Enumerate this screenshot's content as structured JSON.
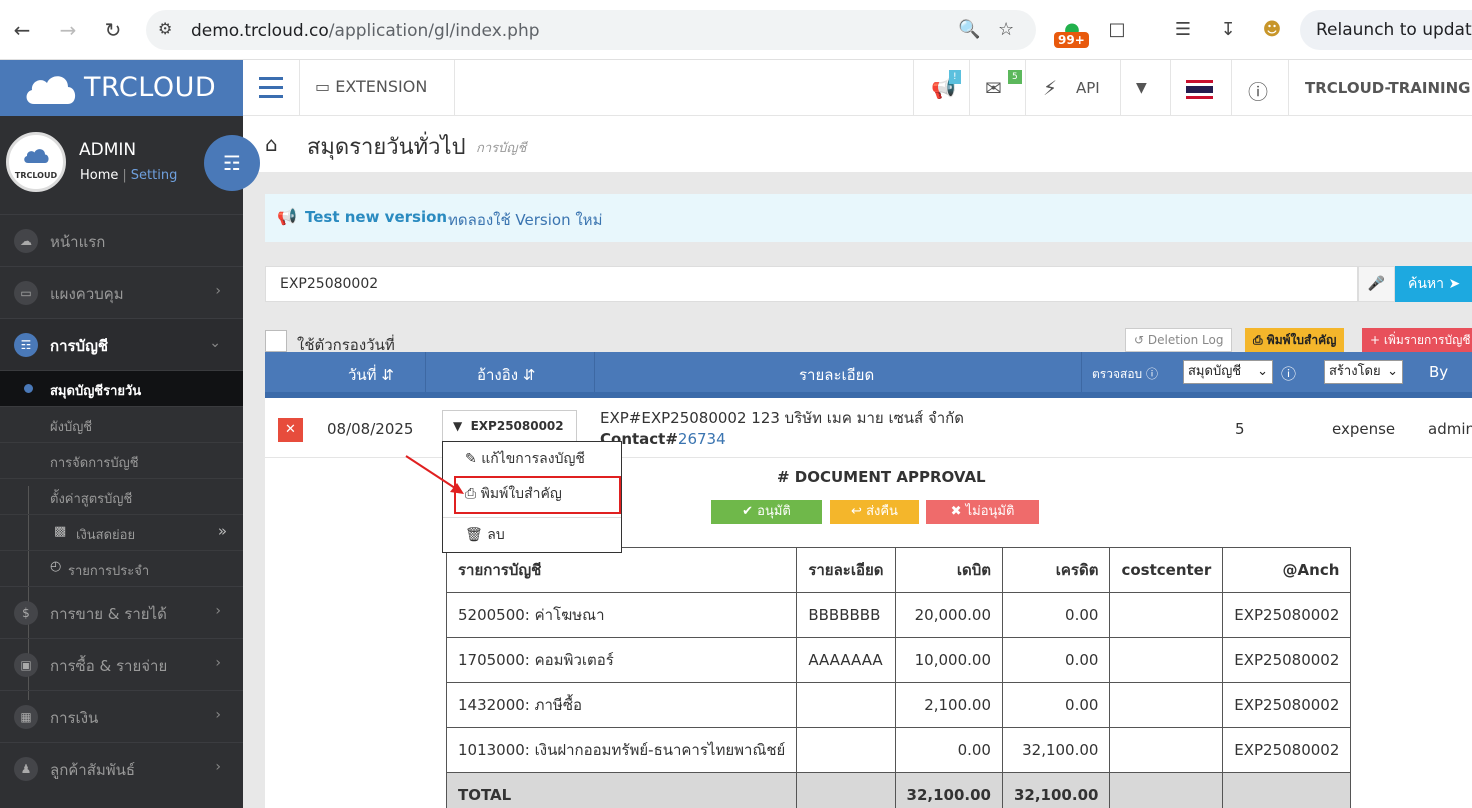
{
  "browser": {
    "url_host": "demo.trcloud.co",
    "url_path": "/application/gl/index.php",
    "badge_count": "99+",
    "relaunch_label": "Relaunch to updat"
  },
  "app": {
    "brand": "TRCLOUD",
    "extension_label": "EXTENSION",
    "announce_badge": "!",
    "mail_badge": "5",
    "api_label": "API",
    "company": "TRCLOUD-TRAINING"
  },
  "profile": {
    "avatar_text": "TRCLOUD",
    "name": "ADMIN",
    "home": "Home",
    "setting": "Setting"
  },
  "sidebar": {
    "items": [
      {
        "label": "หน้าแรก"
      },
      {
        "label": "แผงควบคุม"
      },
      {
        "label": "การบัญชี"
      },
      {
        "label": "การขาย & รายได้"
      },
      {
        "label": "การซื้อ & รายจ่าย"
      },
      {
        "label": "การเงิน"
      },
      {
        "label": "ลูกค้าสัมพันธ์"
      }
    ],
    "sub_items": [
      {
        "label": "สมุดบัญชีรายวัน"
      },
      {
        "label": "ผังบัญชี"
      },
      {
        "label": "การจัดการบัญชี"
      },
      {
        "label": "ตั้งค่าสูตรบัญชี"
      },
      {
        "label": "เงินสดย่อย"
      },
      {
        "label": "รายการประจำ"
      }
    ]
  },
  "page": {
    "title": "สมุดรายวันทั่วไป",
    "subtitle": "การบัญชี"
  },
  "notice": {
    "strong": "Test new version",
    "text": "ทดลองใช้ Version ใหม่"
  },
  "search": {
    "value": "EXP25080002",
    "button": "ค้นหา"
  },
  "toolbar": {
    "date_filter": "ใช้ตัวกรองวันที่",
    "deletion_log": "Deletion Log",
    "print_important": "พิมพ์ใบสำคัญ",
    "add_entry": "เพิ่มรายการบัญชี"
  },
  "table_head": {
    "date": "วันที่",
    "ref": "อ้างอิง",
    "detail": "รายละเอียด",
    "check": "ตรวจสอบ",
    "book_select": "สมุดบัญชี",
    "creator_select": "สร้างโดย",
    "by": "By"
  },
  "entry": {
    "date": "08/08/2025",
    "ref": "EXP25080002",
    "desc_line1": "EXP#EXP25080002 123 บริษัท เมค มาย เซนส์ จำกัด",
    "contact_label": "Contact#",
    "contact_id": "26734",
    "count": "5",
    "type": "expense",
    "by": "admin"
  },
  "dropdown": {
    "edit": "แก้ไขการลงบัญชี",
    "print": "พิมพ์ใบสำคัญ",
    "delete": "ลบ"
  },
  "approval": {
    "title": "# DOCUMENT APPROVAL",
    "approve": "อนุมัติ",
    "return": "ส่งคืน",
    "reject": "ไม่อนุมัติ"
  },
  "gl": {
    "headers": [
      "รายการบัญชี",
      "รายละเอียด",
      "เดบิต",
      "เครดิต",
      "costcenter",
      "@Anch"
    ],
    "rows": [
      [
        "5200500: ค่าโฆษณา",
        "BBBBBBB",
        "20,000.00",
        "0.00",
        "",
        "EXP25080002"
      ],
      [
        "1705000: คอมพิวเตอร์",
        "AAAAAAA",
        "10,000.00",
        "0.00",
        "",
        "EXP25080002"
      ],
      [
        "1432000: ภาษีซื้อ",
        "",
        "2,100.00",
        "0.00",
        "",
        "EXP25080002"
      ],
      [
        "1013000: เงินฝากออมทรัพย์-ธนาคารไทยพาณิชย์",
        "",
        "0.00",
        "32,100.00",
        "",
        "EXP25080002"
      ]
    ],
    "total": [
      "TOTAL",
      "",
      "32,100.00",
      "32,100.00",
      "",
      ""
    ]
  }
}
